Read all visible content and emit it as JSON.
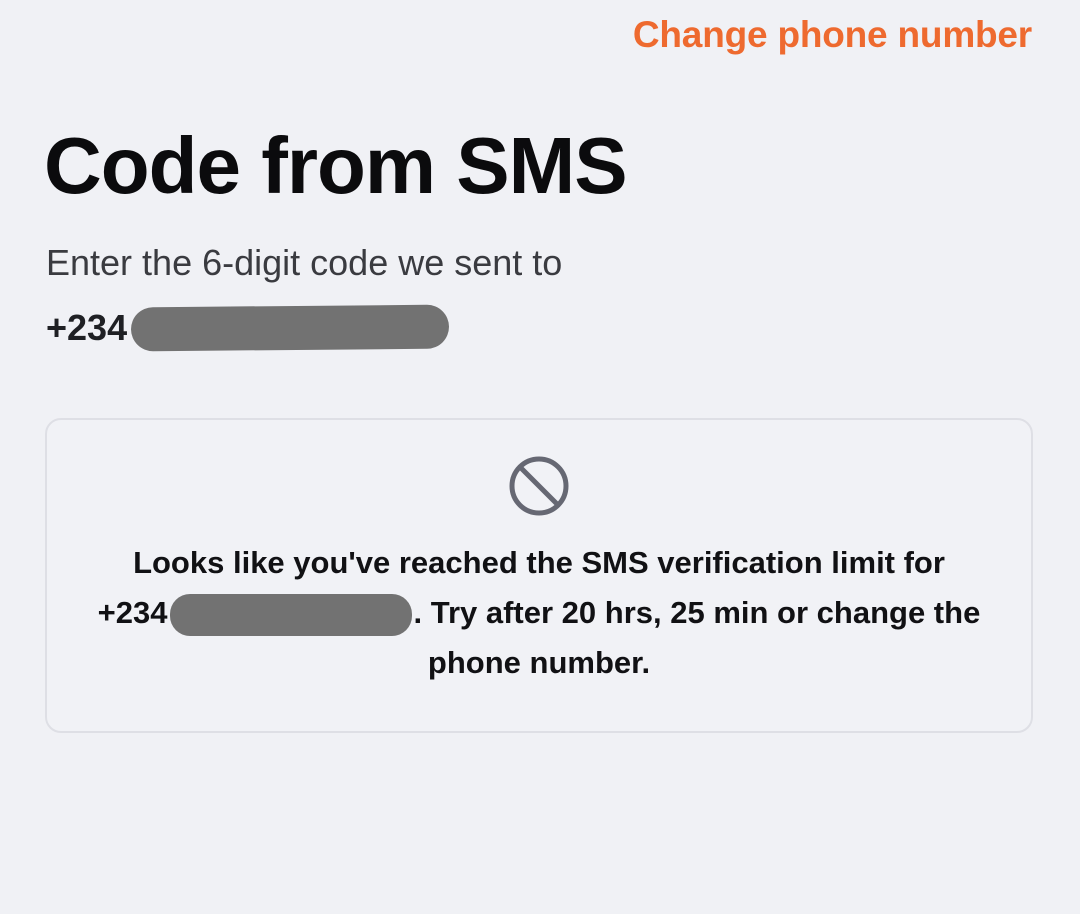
{
  "header": {
    "change_link_label": "Change phone number"
  },
  "main": {
    "title": "Code from SMS",
    "subtitle": "Enter the 6-digit code we sent to",
    "phone_prefix": "+234"
  },
  "alert": {
    "icon": "prohibited-icon",
    "text_before": "Looks like you've reached the SMS verification limit for",
    "phone_prefix": "+234",
    "text_after": ". Try after 20 hrs, 25 min or change the phone number."
  },
  "colors": {
    "accent": "#ee6a2f",
    "background": "#f0f1f5",
    "redaction": "#727272"
  }
}
